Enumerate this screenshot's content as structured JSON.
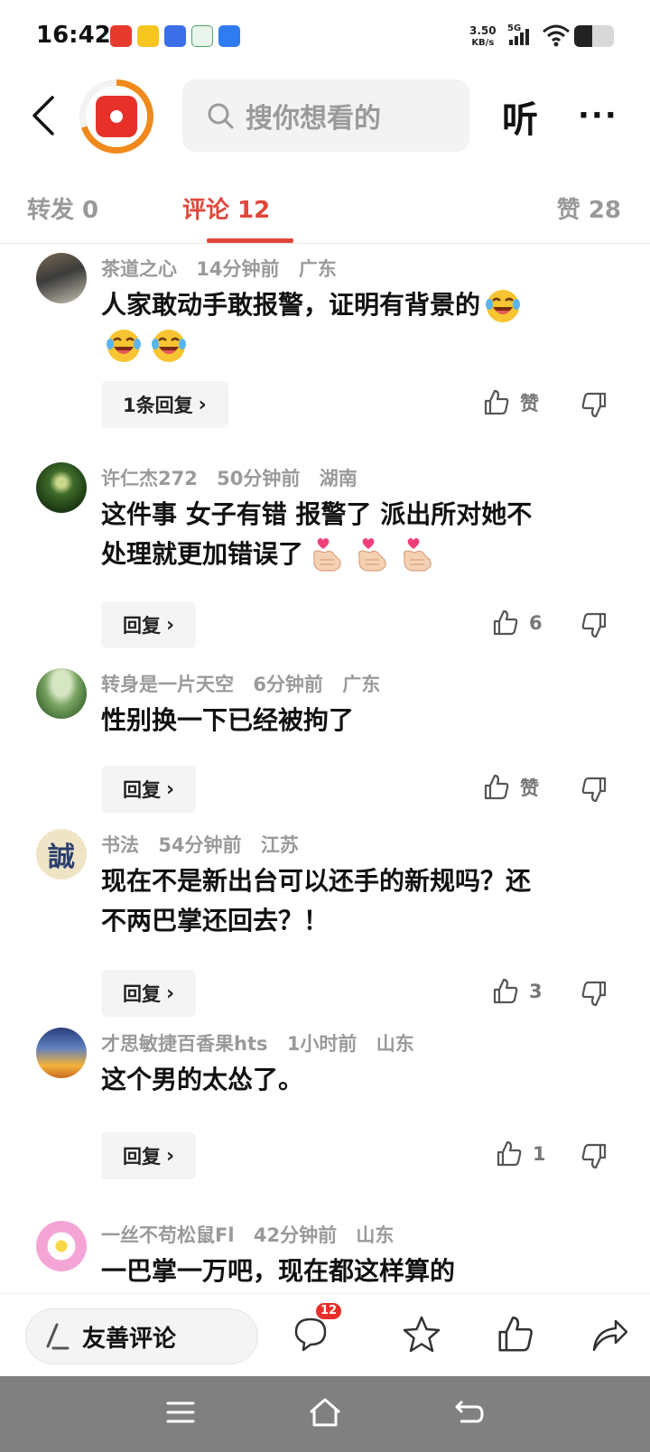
{
  "status_bar": {
    "time": "16:42",
    "net_speed_value": "3.50",
    "net_speed_unit": "KB/s",
    "network": "5G"
  },
  "header": {
    "search_placeholder": "搜你想看的",
    "listen_label": "听",
    "more_label": "···"
  },
  "tabs": [
    {
      "label": "转发 0"
    },
    {
      "label": "评论 12"
    },
    {
      "label": "赞 28"
    }
  ],
  "comments": [
    {
      "user": "茶道之心",
      "time": "14分钟前",
      "location": "广东",
      "text": "人家敢动手敢报警，证明有背景的",
      "reply_label": "1条回复",
      "likes": "赞"
    },
    {
      "user": "许仁杰272",
      "time": "50分钟前",
      "location": "湖南",
      "text_line1": "这件事 女子有错 报警了 派出所对她不",
      "text_line2": "处理就更加错误了",
      "reply_label": "回复",
      "likes": "6"
    },
    {
      "user": "转身是一片天空",
      "time": "6分钟前",
      "location": "广东",
      "text": "性别换一下已经被拘了",
      "reply_label": "回复",
      "likes": "赞"
    },
    {
      "user": "书法",
      "time": "54分钟前",
      "location": "江苏",
      "text_line1": "现在不是新出台可以还手的新规吗？还",
      "text_line2": "不两巴掌还回去？！",
      "reply_label": "回复",
      "likes": "3"
    },
    {
      "user": "才思敏捷百香果hts",
      "time": "1小时前",
      "location": "山东",
      "text": "这个男的太怂了。",
      "reply_label": "回复",
      "likes": "1"
    },
    {
      "user": "一丝不苟松鼠Fl",
      "time": "42分钟前",
      "location": "山东",
      "text": "一巴掌一万吧，现在都这样算的"
    }
  ],
  "avatar_text": {
    "calligraphy": "誠"
  },
  "bottom_bar": {
    "comment_input_label": "友善评论",
    "comment_count_badge": "12"
  },
  "colors": {
    "accent": "#e0473c",
    "brand_red": "#e8302b",
    "brand_orange": "#f08a1c",
    "muted_text": "#9a9a9a",
    "nav_bar": "#808080"
  }
}
